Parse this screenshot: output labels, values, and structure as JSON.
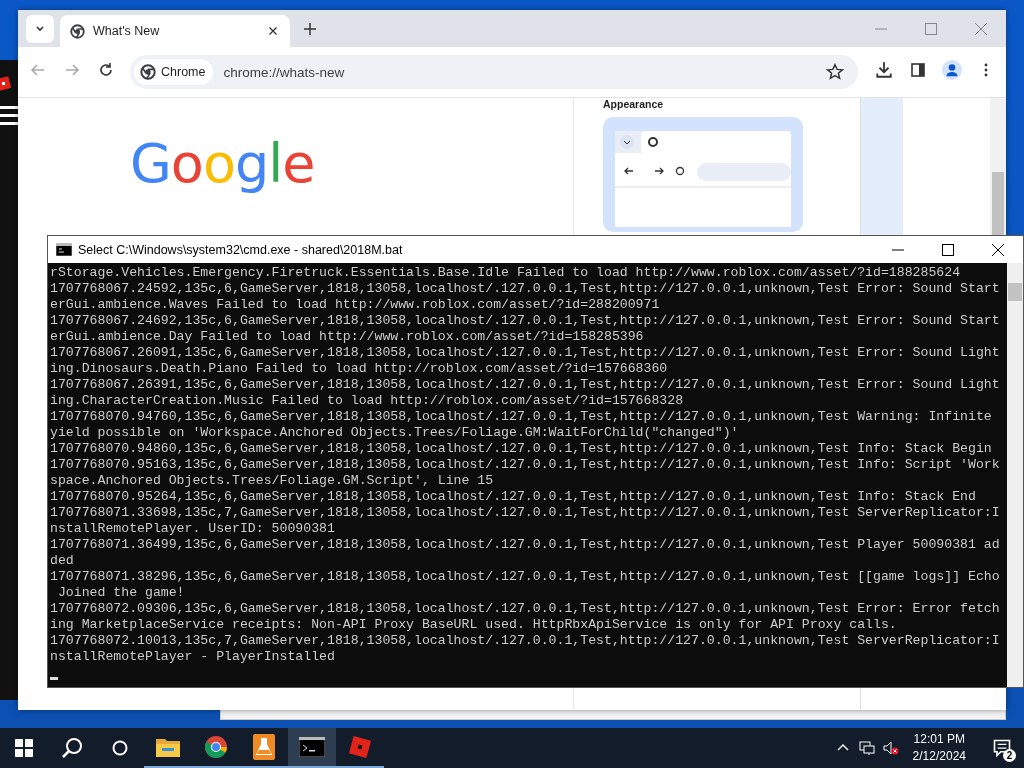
{
  "browser": {
    "tabs": [
      {
        "title": "What's New",
        "selected": true
      }
    ],
    "address_bar": {
      "chip": "Chrome",
      "url": "chrome://whats-new"
    },
    "page": {
      "logo": "Google",
      "appearance_card": {
        "title": "Appearance"
      }
    }
  },
  "console": {
    "title": "Select C:\\Windows\\system32\\cmd.exe - shared\\2018M.bat",
    "lines": [
      "rStorage.Vehicles.Emergency.Firetruck.Essentials.Base.Idle Failed to load http://www.roblox.com/asset/?id=188285624",
      "1707768067.24592,135c,6,GameServer,1818,13058,localhost/.127.0.0.1,Test,http://127.0.0.1,unknown,Test Error: Sound Start",
      "erGui.ambience.Waves Failed to load http://www.roblox.com/asset/?id=288200971",
      "1707768067.24692,135c,6,GameServer,1818,13058,localhost/.127.0.0.1,Test,http://127.0.0.1,unknown,Test Error: Sound Start",
      "erGui.ambience.Day Failed to load http://www.roblox.com/asset/?id=158285396",
      "1707768067.26091,135c,6,GameServer,1818,13058,localhost/.127.0.0.1,Test,http://127.0.0.1,unknown,Test Error: Sound Light",
      "ing.Dinosaurs.Death.Piano Failed to load http://roblox.com/asset/?id=157668360",
      "1707768067.26391,135c,6,GameServer,1818,13058,localhost/.127.0.0.1,Test,http://127.0.0.1,unknown,Test Error: Sound Light",
      "ing.CharacterCreation.Music Failed to load http://roblox.com/asset/?id=157668328",
      "1707768070.94760,135c,6,GameServer,1818,13058,localhost/.127.0.0.1,Test,http://127.0.0.1,unknown,Test Warning: Infinite",
      "yield possible on 'Workspace.Anchored Objects.Trees/Foliage.GM:WaitForChild(\"changed\")'",
      "1707768070.94860,135c,6,GameServer,1818,13058,localhost/.127.0.0.1,Test,http://127.0.0.1,unknown,Test Info: Stack Begin",
      "1707768070.95163,135c,6,GameServer,1818,13058,localhost/.127.0.0.1,Test,http://127.0.0.1,unknown,Test Info: Script 'Work",
      "space.Anchored Objects.Trees/Foliage.GM.Script', Line 15",
      "1707768070.95264,135c,6,GameServer,1818,13058,localhost/.127.0.0.1,Test,http://127.0.0.1,unknown,Test Info: Stack End",
      "1707768071.33698,135c,7,GameServer,1818,13058,localhost/.127.0.0.1,Test,http://127.0.0.1,unknown,Test ServerReplicator:I",
      "nstallRemotePlayer. UserID: 50090381",
      "1707768071.36499,135c,6,GameServer,1818,13058,localhost/.127.0.0.1,Test,http://127.0.0.1,unknown,Test Player 50090381 ad",
      "ded",
      "1707768071.38296,135c,6,GameServer,1818,13058,localhost/.127.0.0.1,Test,http://127.0.0.1,unknown,Test [[game logs]] Echo",
      " Joined the game!",
      "1707768072.09306,135c,6,GameServer,1818,13058,localhost/.127.0.0.1,Test,http://127.0.0.1,unknown,Test Error: Error fetch",
      "ing MarketplaceService receipts: Non-API Proxy BaseURL used. HttpRbxApiService is only for API Proxy calls.",
      "1707768072.10013,135c,7,GameServer,1818,13058,localhost/.127.0.0.1,Test,http://127.0.0.1,unknown,Test ServerReplicator:I",
      "nstallRemotePlayer - PlayerInstalled"
    ]
  },
  "taskbar": {
    "apps": [
      {
        "kind": "explorer",
        "selected": false
      },
      {
        "kind": "chrome",
        "selected": false
      },
      {
        "kind": "flask",
        "selected": false
      },
      {
        "kind": "terminal",
        "selected": true
      },
      {
        "kind": "roblox",
        "selected": false
      }
    ],
    "clock": {
      "time": "12:01 PM",
      "date": "2/12/2024"
    },
    "notifications": "2"
  }
}
